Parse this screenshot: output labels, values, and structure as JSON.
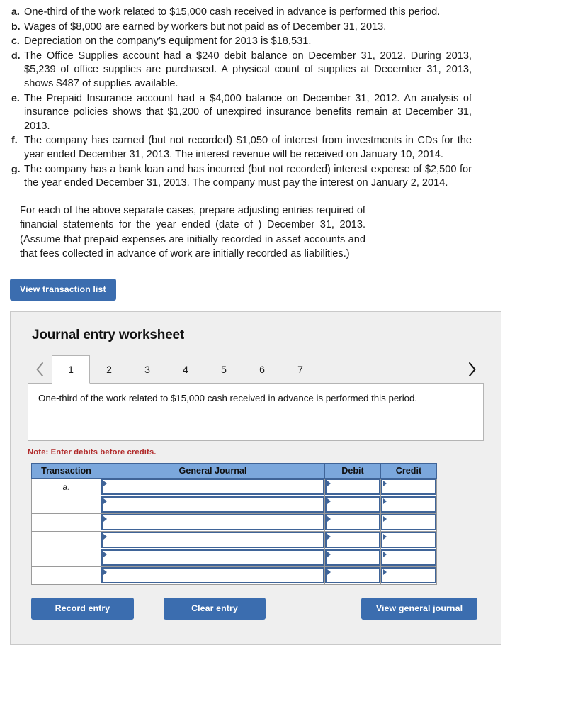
{
  "problem": {
    "cases": [
      {
        "letter": "a.",
        "text": "One-third of the work related to $15,000 cash received in advance is performed this period."
      },
      {
        "letter": "b.",
        "text": "Wages of $8,000 are earned by workers but not paid as of December 31, 2013."
      },
      {
        "letter": "c.",
        "text": "Depreciation on the company’s equipment for 2013 is $18,531."
      },
      {
        "letter": "d.",
        "text": "The Office Supplies account had a $240 debit balance on December 31, 2012. During 2013, $5,239 of office supplies are purchased. A physical count of supplies at December 31, 2013, shows $487 of supplies available."
      },
      {
        "letter": "e.",
        "text": "The Prepaid Insurance account had a $4,000 balance on December 31, 2012. An analysis of insurance policies shows that $1,200 of unexpired insurance benefits remain at December 31, 2013."
      },
      {
        "letter": "f.",
        "text": "The company has earned (but not recorded) $1,050 of interest from investments in CDs for the year ended December 31, 2013. The interest revenue will be received on January 10, 2014."
      },
      {
        "letter": "g.",
        "text": "The company has a bank loan and has incurred (but not recorded) interest expense of $2,500 for the year ended December 31, 2013. The company must pay the interest on January 2, 2014."
      }
    ],
    "instructions": "For each of the above separate cases, prepare adjusting entries required of financial statements for the year ended (date of ) December 31, 2013. (Assume that prepaid expenses are initially recorded in asset accounts and that fees collected in advance of work are initially recorded as liabilities.)"
  },
  "toolbar": {
    "view_transaction_list_label": "View transaction list"
  },
  "worksheet": {
    "title": "Journal entry worksheet",
    "prev_arrow_icon": "chevron-left-icon",
    "next_arrow_icon": "chevron-right-icon",
    "tabs": [
      {
        "label": "1",
        "active": true
      },
      {
        "label": "2",
        "active": false
      },
      {
        "label": "3",
        "active": false
      },
      {
        "label": "4",
        "active": false
      },
      {
        "label": "5",
        "active": false
      },
      {
        "label": "6",
        "active": false
      },
      {
        "label": "7",
        "active": false
      }
    ],
    "description": "One-third of the work related to $15,000 cash received in advance is performed this period.",
    "note": "Note: Enter debits before credits.",
    "table": {
      "headers": [
        "Transaction",
        "General Journal",
        "Debit",
        "Credit"
      ],
      "rows": [
        {
          "transaction": "a.",
          "general_journal": "",
          "debit": "",
          "credit": ""
        },
        {
          "transaction": "",
          "general_journal": "",
          "debit": "",
          "credit": ""
        },
        {
          "transaction": "",
          "general_journal": "",
          "debit": "",
          "credit": ""
        },
        {
          "transaction": "",
          "general_journal": "",
          "debit": "",
          "credit": ""
        },
        {
          "transaction": "",
          "general_journal": "",
          "debit": "",
          "credit": ""
        },
        {
          "transaction": "",
          "general_journal": "",
          "debit": "",
          "credit": ""
        }
      ]
    },
    "actions": {
      "record_label": "Record entry",
      "clear_label": "Clear entry",
      "view_journal_label": "View general journal"
    }
  },
  "colors": {
    "button_blue": "#3b6daf",
    "table_header_blue": "#7ba7dc",
    "cell_border_blue": "#3f6498",
    "note_red": "#b02a2a",
    "panel_gray": "#efefef"
  }
}
